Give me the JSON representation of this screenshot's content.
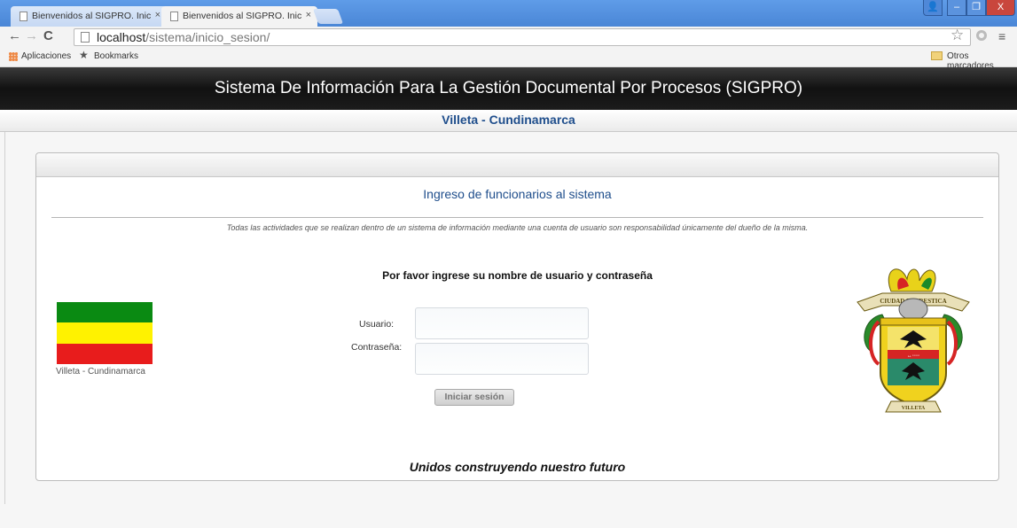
{
  "browser": {
    "tabs": [
      {
        "label": "Bienvenidos al SIGPRO. Inic",
        "close": "×"
      },
      {
        "label": "Bienvenidos al SIGPRO. Inic",
        "close": "×"
      }
    ],
    "url_host": "localhost",
    "url_path": "/sistema/inicio_sesion/",
    "nav": {
      "back": "←",
      "forward": "→",
      "reload": "C"
    },
    "bookmarks": {
      "apps": "Aplicaciones",
      "bookmarks": "Bookmarks",
      "other": "Otros marcadores"
    },
    "window_controls": {
      "user": "👤",
      "min": "–",
      "max": "❐",
      "close": "X"
    }
  },
  "page": {
    "header_title": "Sistema De Información Para La Gestión Documental Por Procesos (SIGPRO)",
    "subheader": "Villeta - Cundinamarca",
    "panel_title": "Ingreso de funcionarios al sistema",
    "disclaimer": "Todas las actividades que se realizan dentro de un sistema de información mediante una cuenta de usuario son responsabilidad únicamente del dueño de la misma.",
    "flag_caption": "Villeta - Cundinamarca",
    "prompt": "Por favor ingrese su nombre de usuario y contraseña",
    "usuario_label": "Usuario:",
    "password_label": "Contraseña:",
    "usuario_value": "",
    "password_value": "",
    "login_button": "Iniciar sesión",
    "motto": "Unidos construyendo nuestro futuro",
    "crest_text": {
      "banner": "CIUDAD FLORESTICA",
      "ribbon": "VILLETA"
    },
    "colors": {
      "flag": [
        "#0a8a12",
        "#fff200",
        "#e81c1c"
      ],
      "accent": "#1f4e8c"
    }
  }
}
